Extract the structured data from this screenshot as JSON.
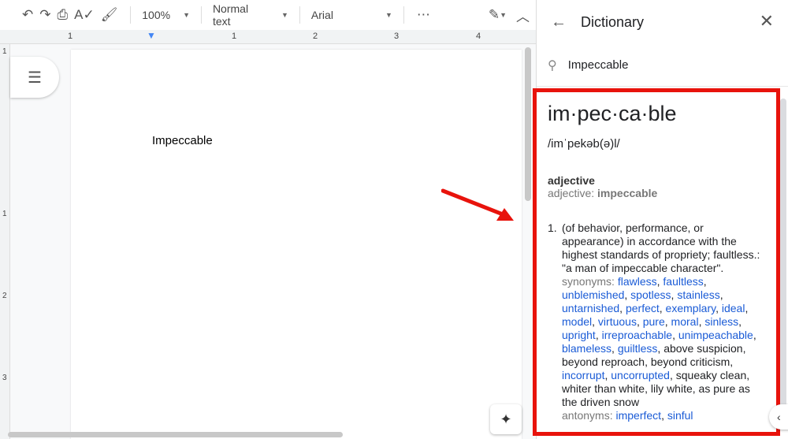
{
  "toolbar": {
    "zoom": "100%",
    "style": "Normal text",
    "font": "Arial"
  },
  "ruler": {
    "h_labels": [
      "1",
      "1",
      "2",
      "3",
      "4"
    ],
    "v_labels": [
      "1",
      "1",
      "2",
      "3"
    ]
  },
  "document": {
    "text": "Impeccable"
  },
  "sidebar": {
    "title": "Dictionary",
    "search_value": "Impeccable",
    "entry": {
      "word": "im·pec·ca·ble",
      "phonetic": "/imˈpekəb(ə)l/",
      "part_of_speech": "adjective",
      "pos_label": "adjective: ",
      "pos_word": "impeccable",
      "definition": {
        "number": "1.",
        "text": "(of behavior, performance, or appearance) in accordance with the highest standards of propriety; faultless.:",
        "example": "\"a man of impeccable character\".",
        "synonyms_label": "synonyms: ",
        "synonyms": [
          {
            "t": "flawless",
            "l": true
          },
          {
            "t": "faultless",
            "l": true
          },
          {
            "t": "unblemished",
            "l": true
          },
          {
            "t": "spotless",
            "l": true
          },
          {
            "t": "stainless",
            "l": true
          },
          {
            "t": "untarnished",
            "l": true
          },
          {
            "t": "perfect",
            "l": true
          },
          {
            "t": "exemplary",
            "l": true
          },
          {
            "t": "ideal",
            "l": true
          },
          {
            "t": "model",
            "l": true
          },
          {
            "t": "virtuous",
            "l": true
          },
          {
            "t": "pure",
            "l": true
          },
          {
            "t": "moral",
            "l": true
          },
          {
            "t": "sinless",
            "l": true
          },
          {
            "t": "upright",
            "l": true
          },
          {
            "t": "irreproachable",
            "l": true
          },
          {
            "t": "unimpeachable",
            "l": true
          },
          {
            "t": "blameless",
            "l": true
          },
          {
            "t": "guiltless",
            "l": true
          },
          {
            "t": "above suspicion",
            "l": false
          },
          {
            "t": "beyond reproach",
            "l": false
          },
          {
            "t": "beyond criticism",
            "l": false
          },
          {
            "t": "incorrupt",
            "l": true
          },
          {
            "t": "uncorrupted",
            "l": true
          },
          {
            "t": "squeaky clean",
            "l": false
          },
          {
            "t": "whiter than white",
            "l": false
          },
          {
            "t": "lily white",
            "l": false
          },
          {
            "t": "as pure as the driven snow",
            "l": false
          }
        ],
        "antonyms_label": "antonyms: ",
        "antonyms": [
          {
            "t": "imperfect",
            "l": true
          },
          {
            "t": "sinful",
            "l": true
          }
        ]
      }
    }
  },
  "colors": {
    "highlight_box": "#e8130c",
    "link": "#1a5bd6"
  }
}
